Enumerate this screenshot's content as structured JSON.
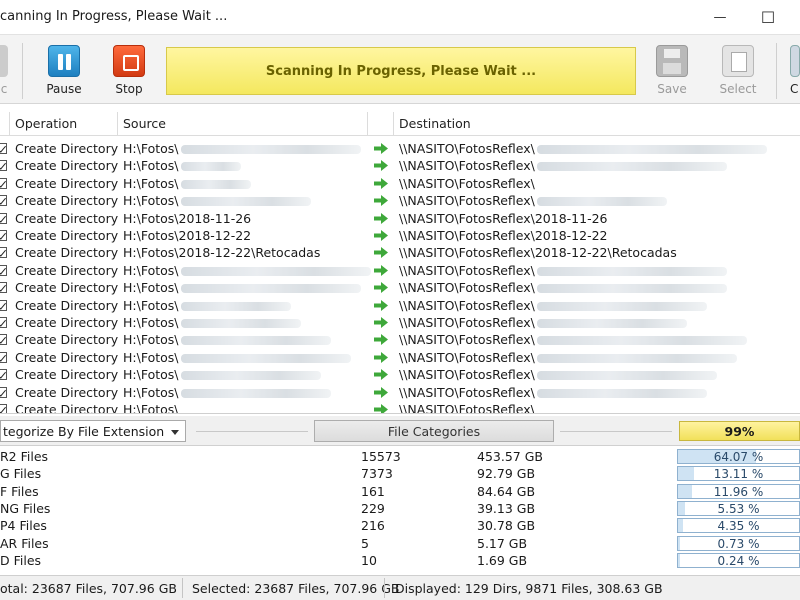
{
  "window": {
    "title": "canning In Progress, Please Wait ...",
    "minimize_glyph": "—",
    "maximize_glyph": "☐"
  },
  "toolbar": {
    "left_partial_label": "c",
    "pause_label": "Pause",
    "stop_label": "Stop",
    "banner_text": "Scanning In Progress, Please Wait ...",
    "save_label": "Save",
    "select_label": "Select",
    "right_partial_label": "C"
  },
  "grid": {
    "columns": {
      "operation": "Operation",
      "source": "Source",
      "destination": "Destination"
    },
    "rows": [
      {
        "operation": "Create Directory",
        "source": "H:\\Fotos\\",
        "destination": "\\\\NASITO\\FotosReflex\\"
      },
      {
        "operation": "Create Directory",
        "source": "H:\\Fotos\\",
        "destination": "\\\\NASITO\\FotosReflex\\"
      },
      {
        "operation": "Create Directory",
        "source": "H:\\Fotos\\",
        "destination": "\\\\NASITO\\FotosReflex\\"
      },
      {
        "operation": "Create Directory",
        "source": "H:\\Fotos\\",
        "destination": "\\\\NASITO\\FotosReflex\\"
      },
      {
        "operation": "Create Directory",
        "source": "H:\\Fotos\\2018-11-26",
        "destination": "\\\\NASITO\\FotosReflex\\2018-11-26"
      },
      {
        "operation": "Create Directory",
        "source": "H:\\Fotos\\2018-12-22",
        "destination": "\\\\NASITO\\FotosReflex\\2018-12-22"
      },
      {
        "operation": "Create Directory",
        "source": "H:\\Fotos\\2018-12-22\\Retocadas",
        "destination": "\\\\NASITO\\FotosReflex\\2018-12-22\\Retocadas"
      },
      {
        "operation": "Create Directory",
        "source": "H:\\Fotos\\",
        "destination": "\\\\NASITO\\FotosReflex\\"
      },
      {
        "operation": "Create Directory",
        "source": "H:\\Fotos\\",
        "destination": "\\\\NASITO\\FotosReflex\\"
      },
      {
        "operation": "Create Directory",
        "source": "H:\\Fotos\\",
        "destination": "\\\\NASITO\\FotosReflex\\"
      },
      {
        "operation": "Create Directory",
        "source": "H:\\Fotos\\",
        "destination": "\\\\NASITO\\FotosReflex\\"
      },
      {
        "operation": "Create Directory",
        "source": "H:\\Fotos\\",
        "destination": "\\\\NASITO\\FotosReflex\\"
      },
      {
        "operation": "Create Directory",
        "source": "H:\\Fotos\\",
        "destination": "\\\\NASITO\\FotosReflex\\"
      },
      {
        "operation": "Create Directory",
        "source": "H:\\Fotos\\",
        "destination": "\\\\NASITO\\FotosReflex\\"
      },
      {
        "operation": "Create Directory",
        "source": "H:\\Fotos\\",
        "destination": "\\\\NASITO\\FotosReflex\\"
      },
      {
        "operation": "Create Directory",
        "source": "H:\\Fotos\\",
        "destination": "\\\\NASITO\\FotosReflex\\"
      }
    ]
  },
  "categorize": {
    "selector_value": "tegorize By File Extension",
    "file_categories_label": "File Categories",
    "progress_text": "99%"
  },
  "categories": [
    {
      "name": "R2 Files",
      "count": "15573",
      "size": "453.57 GB",
      "percent": "64.07 %",
      "fraction": 0.6407
    },
    {
      "name": "G Files",
      "count": "7373",
      "size": "92.79 GB",
      "percent": "13.11 %",
      "fraction": 0.1311
    },
    {
      "name": "F Files",
      "count": "161",
      "size": "84.64 GB",
      "percent": "11.96 %",
      "fraction": 0.1196
    },
    {
      "name": "NG Files",
      "count": "229",
      "size": "39.13 GB",
      "percent": "5.53 %",
      "fraction": 0.0553
    },
    {
      "name": "P4 Files",
      "count": "216",
      "size": "30.78 GB",
      "percent": "4.35 %",
      "fraction": 0.0435
    },
    {
      "name": "AR Files",
      "count": "5",
      "size": "5.17 GB",
      "percent": "0.73 %",
      "fraction": 0.0073
    },
    {
      "name": "D Files",
      "count": "10",
      "size": "1.69 GB",
      "percent": "0.24 %",
      "fraction": 0.0024
    }
  ],
  "status": {
    "total": "otal: 23687 Files, 707.96 GB",
    "selected": "Selected: 23687 Files, 707.96 GB",
    "displayed": "Displayed: 129 Dirs, 9871 Files, 308.63 GB"
  },
  "colors": {
    "banner": "#f4e85f",
    "arrow": "#3ea83a",
    "pause": "#1d7fc0",
    "stop": "#d23a12"
  },
  "icons": {
    "pause": "pause-icon",
    "stop": "stop-icon",
    "save": "save-icon",
    "select": "select-icon",
    "arrow": "arrow-right-icon",
    "checkbox": "checkbox-checked-icon"
  }
}
